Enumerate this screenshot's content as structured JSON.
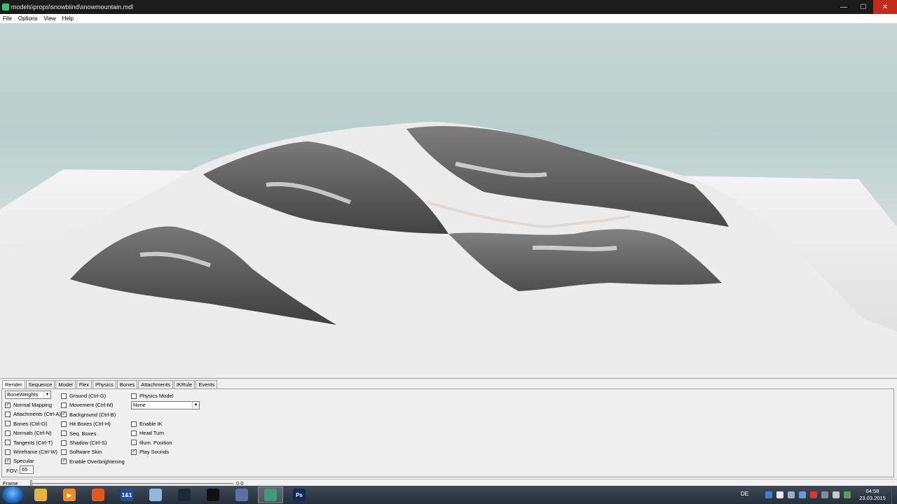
{
  "window": {
    "title": "models\\props\\snowblind\\snowmountain.mdl",
    "minimize": "—",
    "maximize": "☐",
    "close": "✕"
  },
  "menu": [
    "File",
    "Options",
    "View",
    "Help"
  ],
  "tabs": [
    "Render",
    "Sequence",
    "Model",
    "Flex",
    "Physics",
    "Bones",
    "Attachments",
    "IKRule",
    "Events"
  ],
  "active_tab": "Render",
  "render": {
    "mode_select": "BoneWeights",
    "physics_select": "None",
    "col1": [
      {
        "label": "Normal Mapping",
        "checked": true
      },
      {
        "label": "Attachments (Ctrl-A)",
        "checked": false
      },
      {
        "label": "Bones (Ctrl-O)",
        "checked": false
      },
      {
        "label": "Normals (Ctrl-N)",
        "checked": false
      },
      {
        "label": "Tangents (Ctrl-T)",
        "checked": false
      },
      {
        "label": "Wireframe (Ctrl-W)",
        "checked": false
      },
      {
        "label": "Specular",
        "checked": true
      }
    ],
    "col2": [
      {
        "label": "Ground (Ctrl-G)",
        "checked": false
      },
      {
        "label": "Movement (Ctrl-M)",
        "checked": false
      },
      {
        "label": "Background (Ctrl-B)",
        "checked": true
      },
      {
        "label": "Hit Boxes (Ctrl-H)",
        "checked": false
      },
      {
        "label": "Seq. Boxes",
        "checked": false
      },
      {
        "label": "Shadow (Ctrl-S)",
        "checked": false
      },
      {
        "label": "Software Skin",
        "checked": false
      },
      {
        "label": "Enable Overbrightening",
        "checked": true
      }
    ],
    "col3_top": {
      "label": "Physics Model",
      "checked": false
    },
    "col3": [
      {
        "label": "Enable IK",
        "checked": false
      },
      {
        "label": "Head Turn",
        "checked": false
      },
      {
        "label": "Illum. Position",
        "checked": false
      },
      {
        "label": "Play Sounds",
        "checked": true
      }
    ],
    "fov_label": "FOV:",
    "fov_value": "65"
  },
  "frame": {
    "label": "Frame",
    "value": "0.0"
  },
  "taskbar": {
    "language": "DE",
    "time": "04:58",
    "date": "23.03.2015",
    "apps": [
      {
        "name": "explorer",
        "color": "#e6b43c",
        "glyph": "",
        "active": false
      },
      {
        "name": "media-player",
        "color": "#f28b22",
        "glyph": "▶",
        "active": false
      },
      {
        "name": "firefox",
        "color": "#e25a1c",
        "glyph": "",
        "active": false
      },
      {
        "name": "1and1",
        "color": "#1d4f9c",
        "glyph": "1&1",
        "active": false
      },
      {
        "name": "notepad",
        "color": "#8fb8e0",
        "glyph": "",
        "active": false
      },
      {
        "name": "steam",
        "color": "#1b2838",
        "glyph": "",
        "active": false
      },
      {
        "name": "steam-big",
        "color": "#111111",
        "glyph": "",
        "active": false
      },
      {
        "name": "hammer",
        "color": "#5a6fa8",
        "glyph": "",
        "active": false
      },
      {
        "name": "hlmv",
        "color": "#3f9a7a",
        "glyph": "",
        "active": true
      },
      {
        "name": "photoshop",
        "color": "#0f2a59",
        "glyph": "Ps",
        "active": false
      }
    ]
  }
}
